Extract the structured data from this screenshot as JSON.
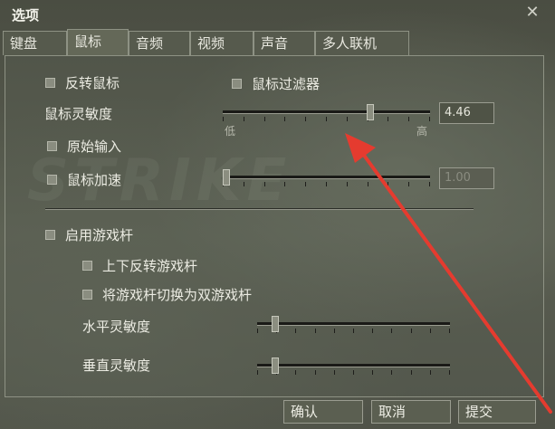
{
  "window": {
    "title": "选项"
  },
  "tabs": [
    {
      "label": "键盘"
    },
    {
      "label": "鼠标"
    },
    {
      "label": "音频"
    },
    {
      "label": "视频"
    },
    {
      "label": "声音"
    },
    {
      "label": "多人联机"
    }
  ],
  "mouse": {
    "reverse_mouse": {
      "label": "反转鼠标",
      "checked": false
    },
    "mouse_filter": {
      "label": "鼠标过滤器",
      "checked": false
    },
    "sensitivity": {
      "label": "鼠标灵敏度",
      "value": "4.46",
      "level": 0.72,
      "low_label": "低",
      "high_label": "高"
    },
    "raw_input": {
      "label": "原始输入",
      "checked": false
    },
    "acceleration": {
      "label": "鼠标加速",
      "value": "1.00",
      "level": 0.0,
      "checked": false
    },
    "joystick": {
      "label": "启用游戏杆",
      "checked": false
    },
    "invert_joystick": {
      "label": "上下反转游戏杆",
      "checked": false
    },
    "dual_joystick": {
      "label": "将游戏杆切换为双游戏杆",
      "checked": false
    },
    "horizontal_sensitivity": {
      "label": "水平灵敏度",
      "level": 0.08
    },
    "vertical_sensitivity": {
      "label": "垂直灵敏度",
      "level": 0.08
    }
  },
  "buttons": {
    "ok": "确认",
    "cancel": "取消",
    "apply": "提交"
  },
  "watermark": "STRIKE",
  "colors": {
    "accent_arrow": "#e53b2f",
    "background": "#4d5044"
  }
}
